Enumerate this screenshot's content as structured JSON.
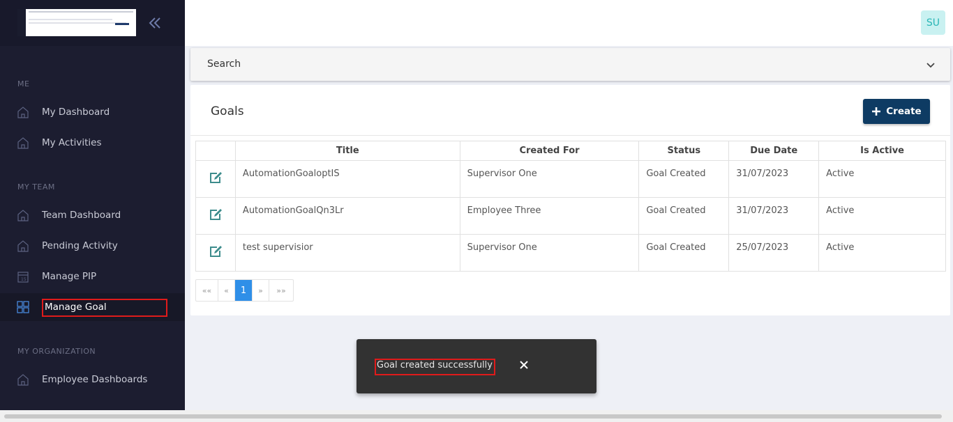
{
  "sidebar": {
    "sections": {
      "me": "ME",
      "my_team": "MY TEAM",
      "my_org": "MY ORGANIZATION"
    },
    "items": [
      {
        "label": "My Dashboard",
        "icon": "home-icon"
      },
      {
        "label": "My Activities",
        "icon": "home-icon"
      },
      {
        "label": "Team Dashboard",
        "icon": "home-icon"
      },
      {
        "label": "Pending Activity",
        "icon": "home-icon"
      },
      {
        "label": "Manage PIP",
        "icon": "calendar-icon"
      },
      {
        "label": "Manage Goal",
        "icon": "grid-icon"
      },
      {
        "label": "Employee Dashboards",
        "icon": "home-icon"
      }
    ]
  },
  "header": {
    "avatar_initials": "SU"
  },
  "search": {
    "label": "Search"
  },
  "goals": {
    "title": "Goals",
    "create_label": "Create",
    "columns": [
      "Title",
      "Created For",
      "Status",
      "Due Date",
      "Is Active"
    ],
    "rows": [
      {
        "title": "AutomationGoaloptIS",
        "created_for": "Supervisor One",
        "status": "Goal Created",
        "due_date": "31/07/2023",
        "is_active": "Active"
      },
      {
        "title": "AutomationGoalQn3Lr",
        "created_for": "Employee Three",
        "status": "Goal Created",
        "due_date": "31/07/2023",
        "is_active": "Active"
      },
      {
        "title": "test supervisior",
        "created_for": "Supervisor One",
        "status": "Goal Created",
        "due_date": "25/07/2023",
        "is_active": "Active"
      }
    ]
  },
  "pagination": {
    "first": "««",
    "prev": "«",
    "current": "1",
    "next": "»",
    "last": "»»"
  },
  "toast": {
    "message": "Goal created successfully",
    "close_glyph": "✕"
  },
  "colors": {
    "sidebar_bg": "#1c1d30",
    "primary_button": "#0e3b63",
    "active_page": "#2f8fe8",
    "highlight": "#e01b1b",
    "edit_icon": "#3d8c8c"
  }
}
